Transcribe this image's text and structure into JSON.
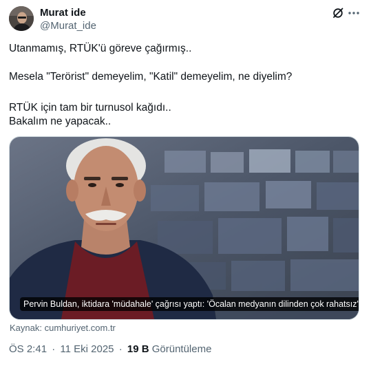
{
  "author": {
    "name": "Murat ide",
    "handle": "@Murat_ide"
  },
  "tweet": {
    "lines": [
      "Utanmamış, RTÜK'ü göreve çağırmış..",
      "Mesela \"Terörist\" demeyelim, \"Katil\" demeyelim, ne diyelim?",
      "RTÜK için tam bir turnusol kağıdı..",
      "Bakalım ne yapacak.."
    ]
  },
  "media": {
    "caption": "Pervin Buldan, iktidara 'müdahale' çağrısı yaptı: 'Öcalan medyanın dilinden çok rahatsız'",
    "source": "Kaynak: cumhuriyet.com.tr"
  },
  "meta": {
    "time": "ÖS 2:41",
    "date": "11 Eki 2025",
    "separator": "·",
    "views_count": "19 B",
    "views_label": "Görüntüleme"
  },
  "icons": {
    "grok": "grok-icon",
    "more": "more-horizontal-icon"
  },
  "colors": {
    "text": "#0f1419",
    "secondary": "#536471",
    "border": "#cfd9de"
  }
}
